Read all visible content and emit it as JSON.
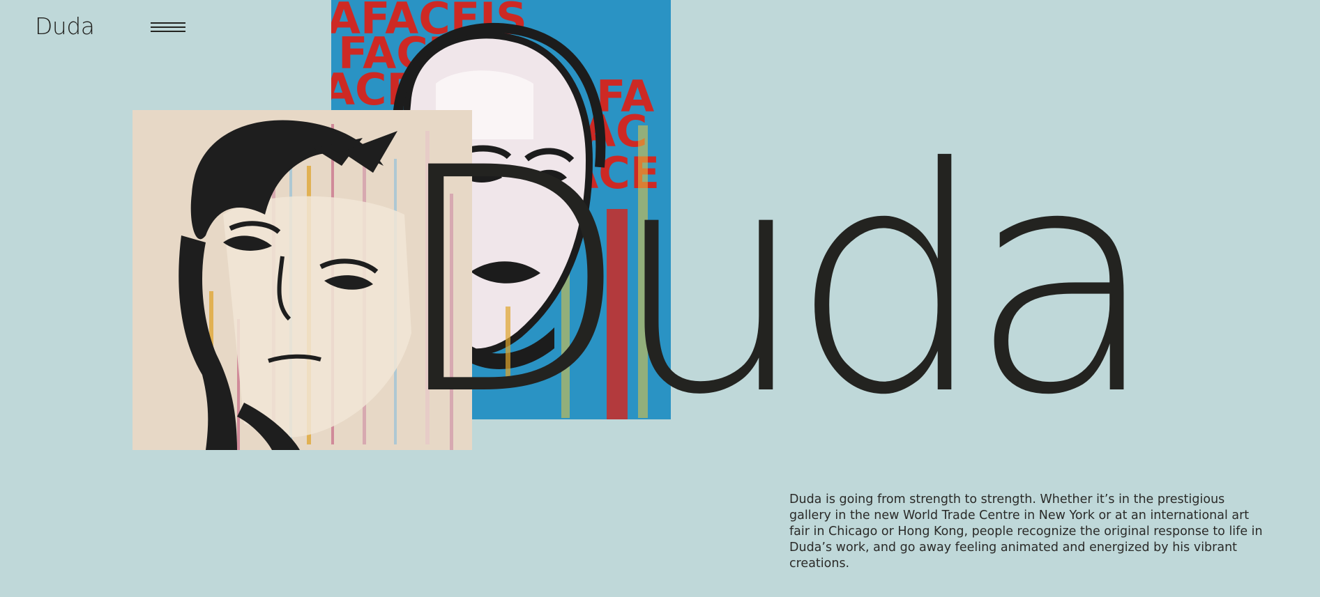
{
  "header": {
    "logo_text": "Duda",
    "menu_icon": "hamburger-menu-icon"
  },
  "hero": {
    "title": "Duda",
    "artworks": [
      {
        "name": "pop-art-face-painting",
        "palette": [
          "#2a93c4",
          "#d6241c",
          "#f2e8ea",
          "#1c1c1c"
        ]
      },
      {
        "name": "drip-portrait-painting",
        "palette": [
          "#e7d8c6",
          "#1e1e1e",
          "#d29aa9",
          "#e0a52d"
        ]
      }
    ]
  },
  "description": {
    "text": "Duda is going from strength to strength. Whether it’s in the prestigious gallery in the new World Trade Centre in New York or at an international art fair in Chicago or Hong Kong, people recognize the original response to life in Duda’s work, and go away feeling animated and energized by his vibrant creations."
  },
  "colors": {
    "background": "#bfd8d9",
    "text": "#232320"
  }
}
